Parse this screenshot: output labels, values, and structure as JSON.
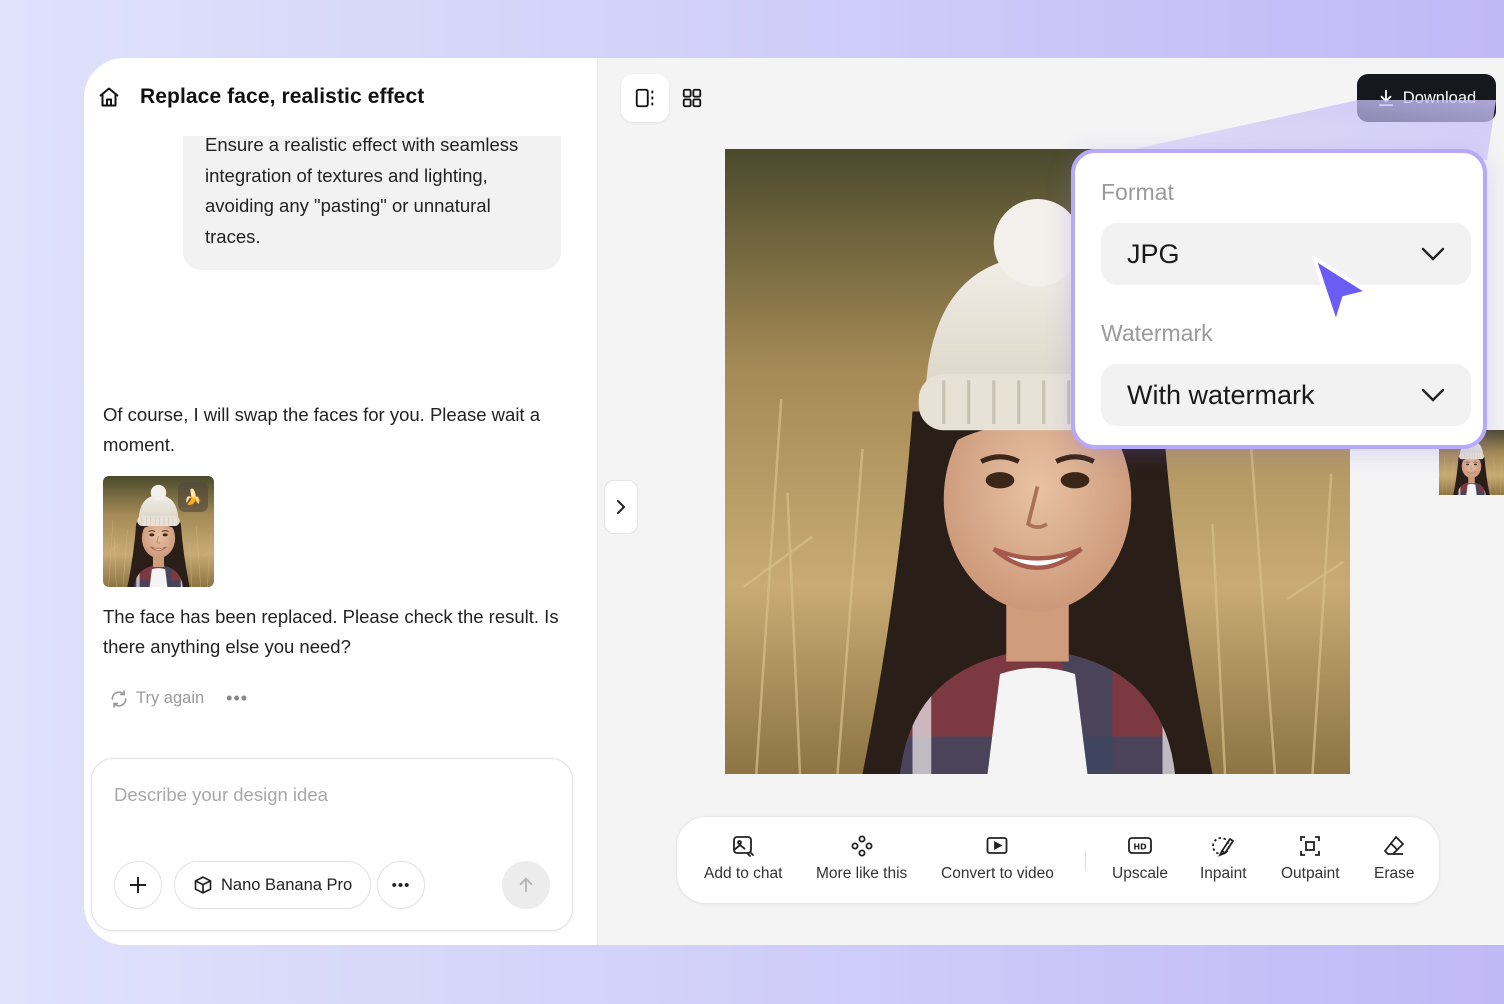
{
  "header": {
    "title": "Replace face, realistic effect"
  },
  "chat": {
    "user_message": "Ensure a realistic effect with seamless integration of textures and lighting, avoiding any \"pasting\" or unnatural traces.",
    "ai_message_1": "Of course, I will swap the faces for you. Please wait a moment.",
    "ai_message_2": "The face has been replaced. Please check the result. Is there anything else you need?",
    "try_again_label": "Try again",
    "thumb_badge": "🍌"
  },
  "composer": {
    "placeholder": "Describe your design idea",
    "model_label": "Nano Banana Pro"
  },
  "toolbar": {
    "download_label": "Download"
  },
  "tools": [
    {
      "label": "Add to chat",
      "icon": "add-to-chat-icon"
    },
    {
      "label": "More like this",
      "icon": "more-like-this-icon"
    },
    {
      "label": "Convert to video",
      "icon": "video-icon"
    },
    {
      "label": "Upscale",
      "icon": "hd-icon"
    },
    {
      "label": "Inpaint",
      "icon": "inpaint-icon"
    },
    {
      "label": "Outpaint",
      "icon": "outpaint-icon"
    },
    {
      "label": "Erase",
      "icon": "eraser-icon"
    }
  ],
  "download_popup": {
    "format_label": "Format",
    "format_value": "JPG",
    "watermark_label": "Watermark",
    "watermark_value": "With watermark"
  },
  "colors": {
    "accent": "#6b5cf5",
    "popup_border": "#b6a9f7",
    "download_button": "#15191e"
  }
}
